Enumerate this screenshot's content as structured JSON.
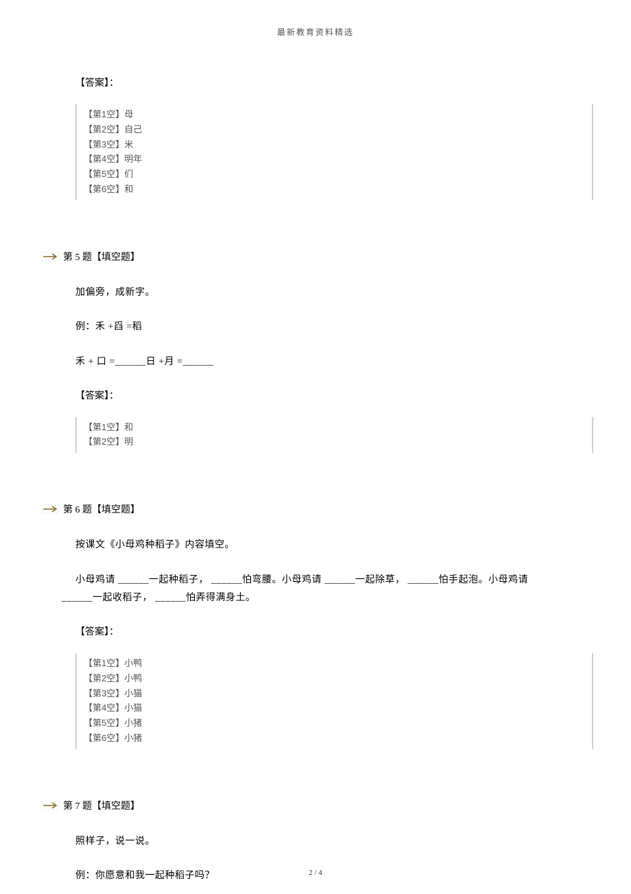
{
  "header": {
    "title": "最新教育资料精选"
  },
  "q4": {
    "answer_label": "【答案】：",
    "answers": [
      "【第1空】母",
      "【第2空】自己",
      "【第3空】米",
      "【第4空】明年",
      "【第5空】们",
      "【第6空】和"
    ]
  },
  "q5": {
    "title_prefix": "第",
    "title_num": "5",
    "title_suffix": "题【填空题】",
    "line1": "加偏旁，成新字。",
    "line2": "例：禾 +舀 =稻",
    "line3": "禾 +  口 =______日 +月 =______",
    "answer_label": "【答案】：",
    "answers": [
      "【第1空】和",
      "【第2空】明"
    ]
  },
  "q6": {
    "title_prefix": "第",
    "title_num": "6",
    "title_suffix": "题【填空题】",
    "line1": "按课文《小母鸡种稻子》内容填空。",
    "line2_a": "小母鸡请  ______一起种稻子，   ______怕弯腰。小母鸡请   ______一起除草，   ______怕手起泡。小母鸡请",
    "line2_b": "______一起收稻子，   ______怕弄得满身土。",
    "answer_label": "【答案】：",
    "answers": [
      "【第1空】小鸭",
      "【第2空】小鸭",
      "【第3空】小猫",
      "【第4空】小猫",
      "【第5空】小猪",
      "【第6空】小猪"
    ]
  },
  "q7": {
    "title_prefix": "第",
    "title_num": "7",
    "title_suffix": "题【填空题】",
    "line1": "照样子，说一说。",
    "line2": "例：你愿意和我一起种稻子吗？"
  },
  "footer": {
    "page": "2",
    "sep": " / ",
    "total": "4"
  }
}
